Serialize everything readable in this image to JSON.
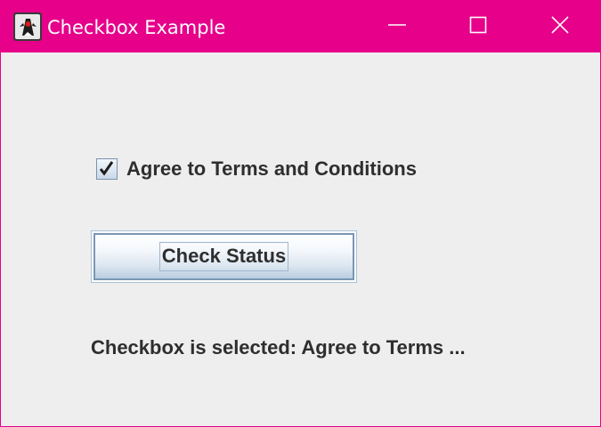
{
  "window": {
    "title": "Checkbox Example",
    "icon": "java-duke-icon",
    "controls": {
      "minimize_icon": "minimize-icon",
      "maximize_icon": "maximize-icon",
      "close_icon": "close-icon"
    },
    "colors": {
      "titlebar": "#e6008a",
      "background": "#eeeeee",
      "text": "#2e2e2e"
    }
  },
  "content": {
    "checkbox": {
      "label": "Agree to Terms and Conditions",
      "checked": true,
      "check_glyph": "🗸"
    },
    "button": {
      "label": "Check Status"
    },
    "status": {
      "text": "Checkbox is selected: Agree to Terms ..."
    }
  }
}
